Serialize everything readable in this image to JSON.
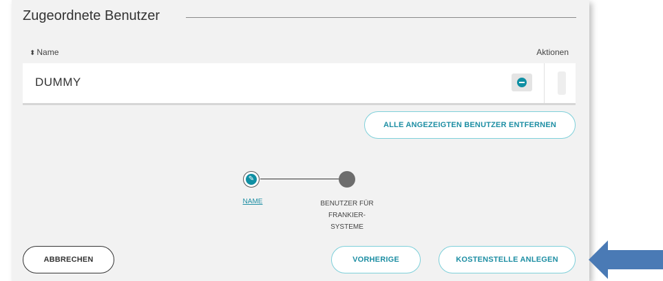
{
  "section": {
    "title": "Zugeordnete Benutzer"
  },
  "table": {
    "col_name": "Name",
    "col_actions": "Aktionen",
    "rows": [
      {
        "name": "DUMMY"
      }
    ]
  },
  "buttons": {
    "remove_all": "ALLE ANGEZEIGTEN BENUTZER ENTFERNEN",
    "cancel": "ABBRECHEN",
    "previous": "VORHERIGE",
    "create_cost_center": "KOSTENSTELLE ANLEGEN"
  },
  "stepper": {
    "steps": [
      {
        "label": "NAME",
        "state": "editable"
      },
      {
        "label_lines": [
          "BENUTZER FÜR",
          "FRANKIER-",
          "SYSTEME"
        ],
        "state": "current"
      }
    ]
  },
  "icons": {
    "sort": "sort-updown-icon",
    "remove": "minus-circle-icon",
    "edit": "pencil-icon",
    "annotation": "arrow-left-icon"
  },
  "colors": {
    "accent": "#0f8fa3",
    "accent_border": "#7ccfd9",
    "annotation_arrow": "#4a7ab5",
    "panel_bg": "#f2f2f2"
  }
}
